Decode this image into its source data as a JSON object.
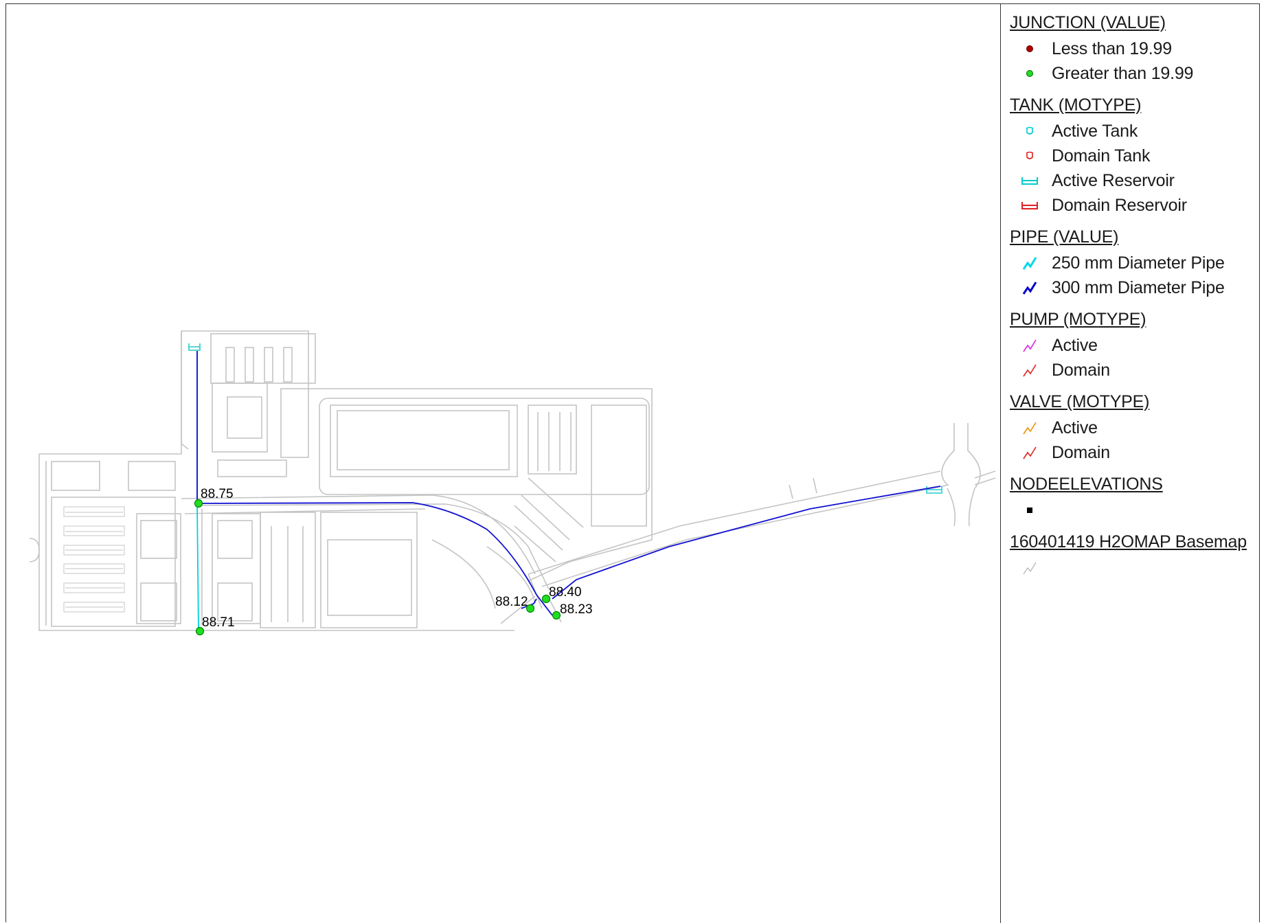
{
  "legend": {
    "sections": [
      {
        "heading": "JUNCTION (VALUE)",
        "items": [
          {
            "label": "Less than 19.99",
            "icon": "junction-dot-icon",
            "color": "#b00000"
          },
          {
            "label": "Greater than 19.99",
            "icon": "junction-dot-icon",
            "color": "#00b000"
          }
        ]
      },
      {
        "heading": "TANK (MOTYPE)",
        "items": [
          {
            "label": "Active Tank",
            "icon": "tank-icon",
            "color": "#00cccc"
          },
          {
            "label": "Domain Tank",
            "icon": "tank-icon",
            "color": "#e02020"
          },
          {
            "label": "Active Reservoir",
            "icon": "reservoir-icon",
            "color": "#00cccc"
          },
          {
            "label": "Domain Reservoir",
            "icon": "reservoir-icon",
            "color": "#e02020"
          }
        ]
      },
      {
        "heading": "PIPE (VALUE)",
        "items": [
          {
            "label": "250 mm Diameter Pipe",
            "icon": "pipe-zigzag-icon",
            "color": "#00d8e8"
          },
          {
            "label": "300 mm Diameter Pipe",
            "icon": "pipe-zigzag-icon",
            "color": "#0000cc"
          }
        ]
      },
      {
        "heading": "PUMP (MOTYPE)",
        "items": [
          {
            "label": "Active",
            "icon": "pump-zigzag-icon",
            "color": "#e020e0"
          },
          {
            "label": "Domain",
            "icon": "pump-zigzag-icon",
            "color": "#e02020"
          }
        ]
      },
      {
        "heading": "VALVE (MOTYPE)",
        "items": [
          {
            "label": "Active",
            "icon": "valve-zigzag-icon",
            "color": "#f09000"
          },
          {
            "label": "Domain",
            "icon": "valve-zigzag-icon",
            "color": "#e02020"
          }
        ]
      },
      {
        "heading": "NODEELEVATIONS",
        "items": [
          {
            "label": "",
            "icon": "square-marker-icon",
            "color": "#000000"
          }
        ]
      },
      {
        "heading": "160401419 H2OMAP Basemap",
        "items": [
          {
            "label": "",
            "icon": "basemap-line-icon",
            "color": "#bbbbbb"
          }
        ]
      }
    ]
  },
  "map": {
    "junctions": [
      {
        "label": "88.75",
        "status": "Greater than 19.99"
      },
      {
        "label": "88.71",
        "status": "Greater than 19.99"
      },
      {
        "label": "88.40",
        "status": "Greater than 19.99"
      },
      {
        "label": "88.12",
        "status": "Greater than 19.99"
      },
      {
        "label": "88.23",
        "status": "Greater than 19.99"
      }
    ],
    "colors": {
      "junction": "#22dd22",
      "pipe_250": "#00d8e8",
      "pipe_300": "#0000cc",
      "basemap": "#c8c8c8",
      "reservoir": "#00cccc"
    }
  }
}
